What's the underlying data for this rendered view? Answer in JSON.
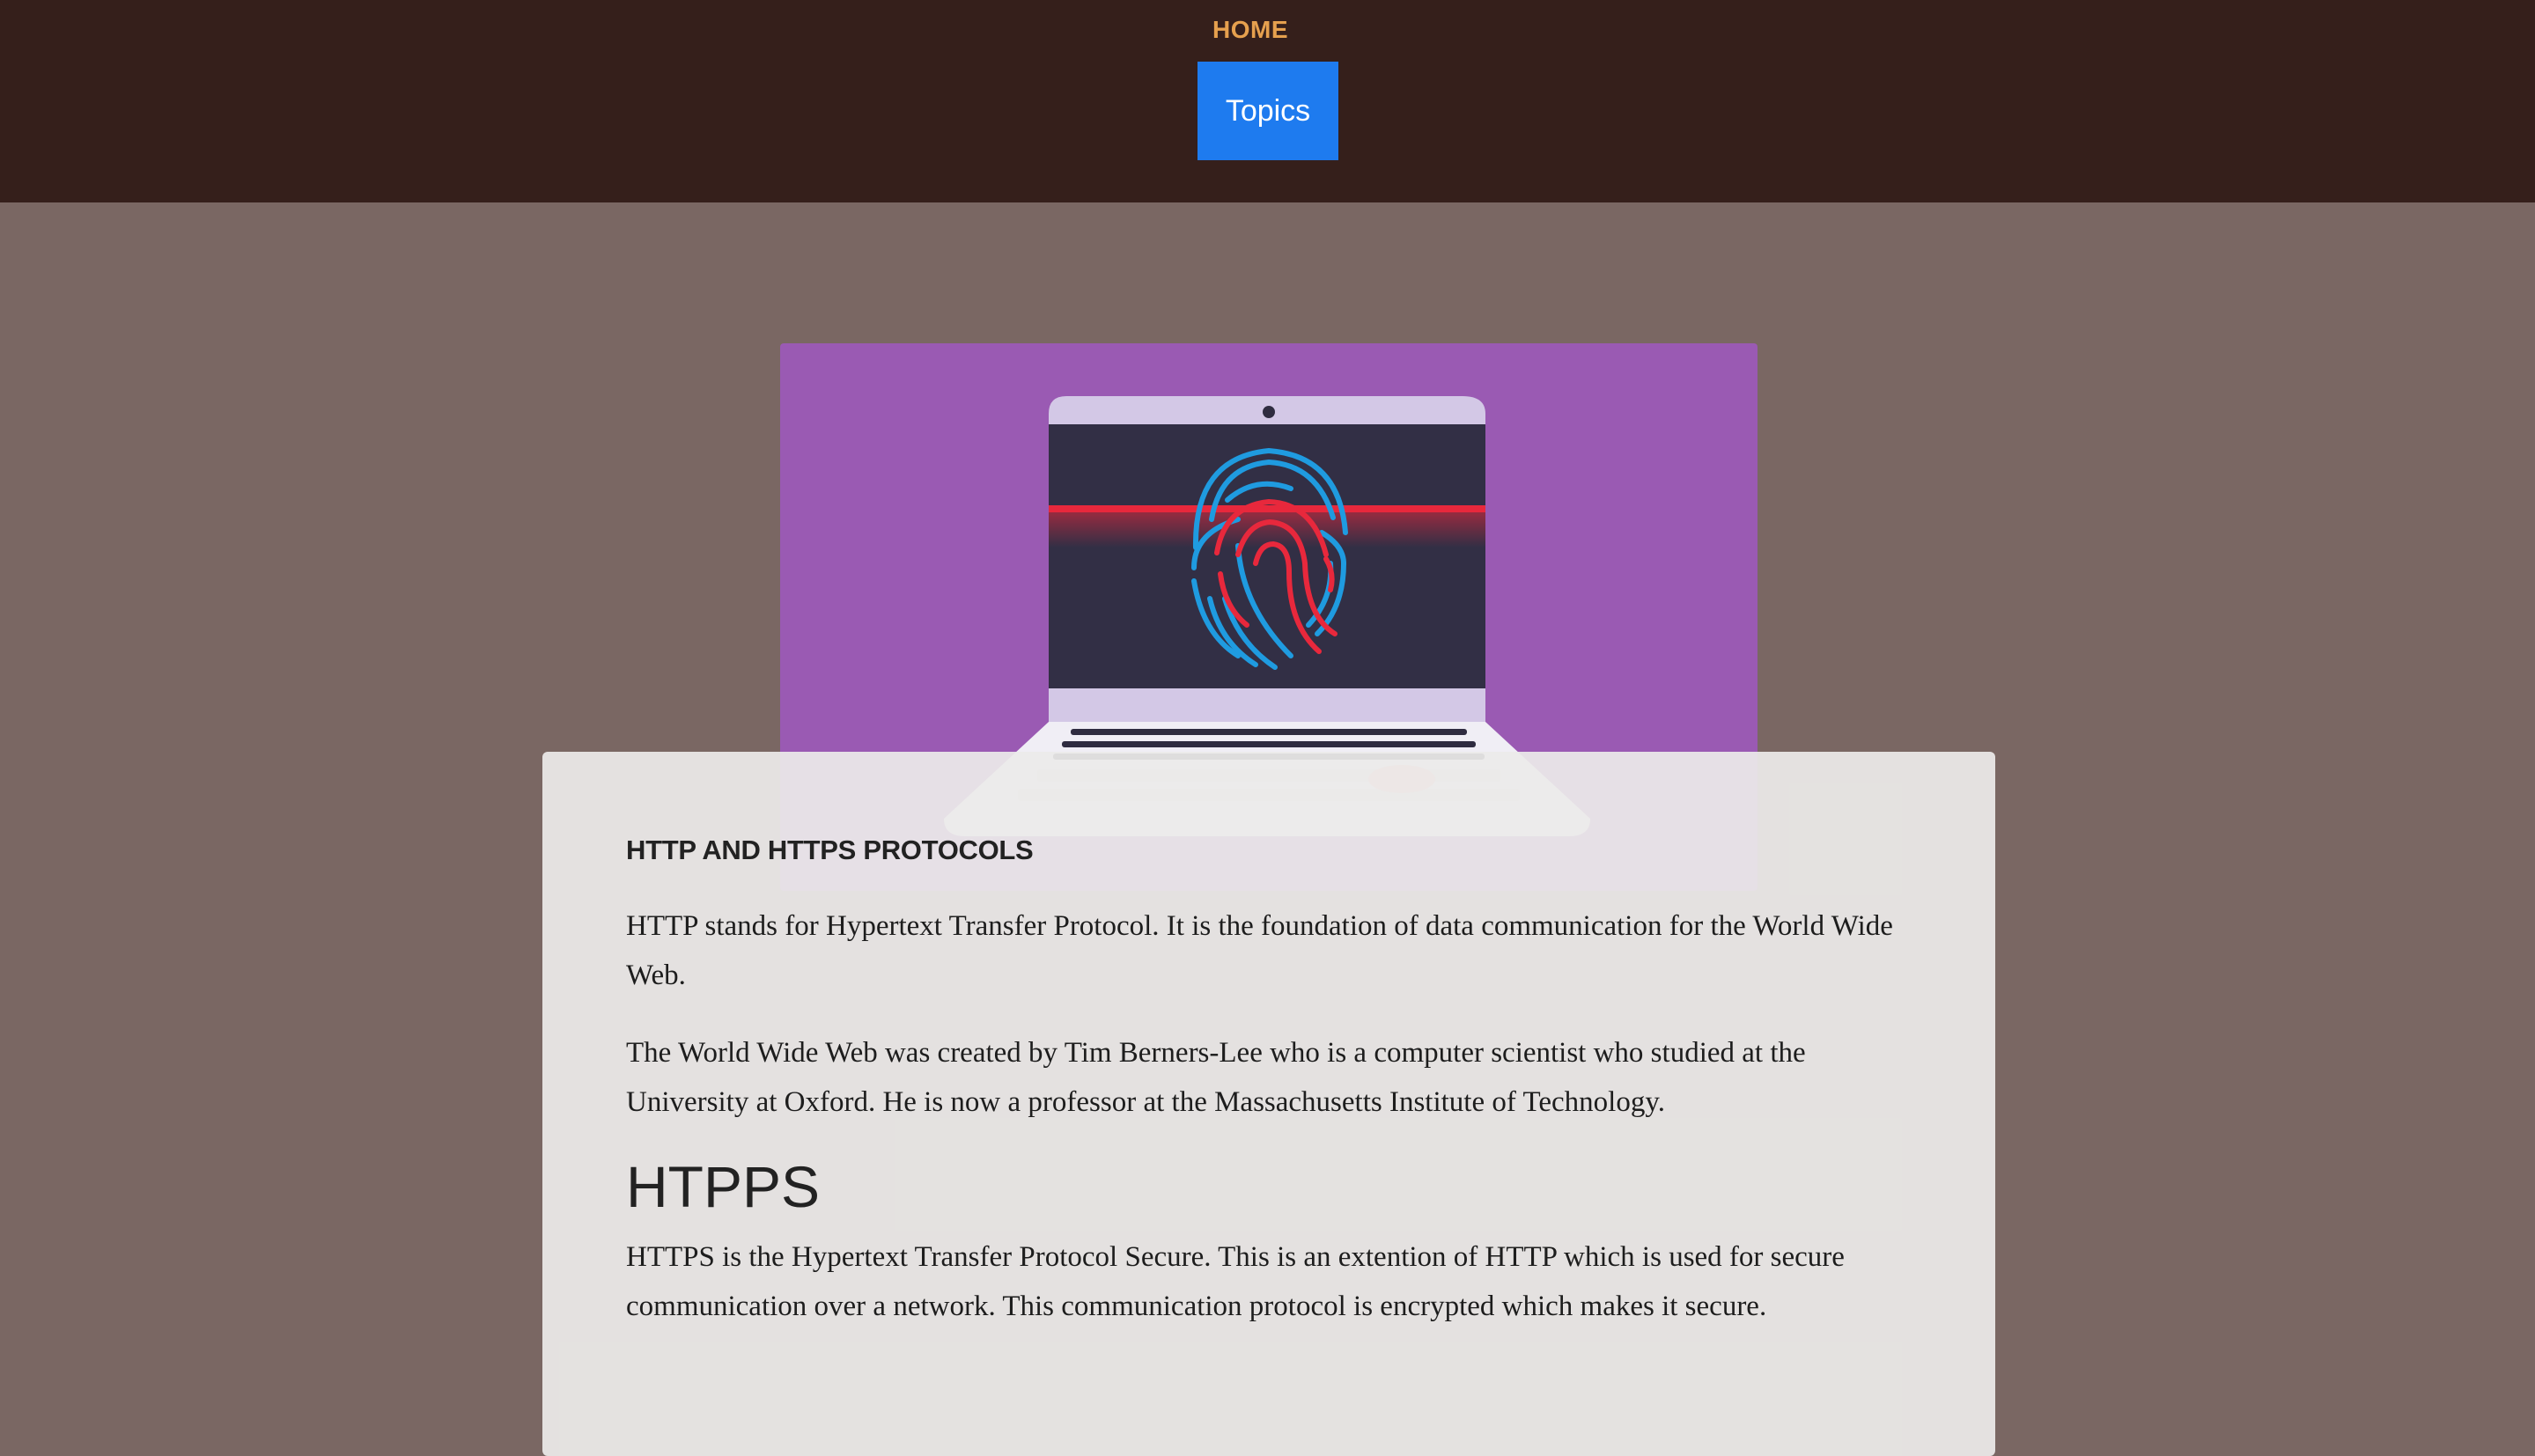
{
  "nav": {
    "home_label": "HOME",
    "topics_label": "Topics"
  },
  "hero": {
    "image": "laptop-fingerprint-illustration"
  },
  "article": {
    "title": "HTTP AND HTTPS PROTOCOLS",
    "paragraphs": [
      "HTTP stands for Hypertext Transfer Protocol. It is the foundation of data communication for the World Wide Web.",
      "The World Wide Web was created by Tim Berners-Lee who is a computer scientist who studied at the University at Oxford. He is now a professor at the Massachusetts Institute of Technology."
    ],
    "subheading": "HTPPS",
    "https_paragraph": "HTTPS is the Hypertext Transfer Protocol Secure. This is an extention of HTTP which is used for secure communication over a network. This communication protocol is encrypted which makes it secure."
  },
  "colors": {
    "header_bg": "#351f1b",
    "page_bg": "#7a6763",
    "accent_home": "#e6a04e",
    "button_bg": "#1e7bef",
    "hero_bg": "#9a5ab3"
  }
}
